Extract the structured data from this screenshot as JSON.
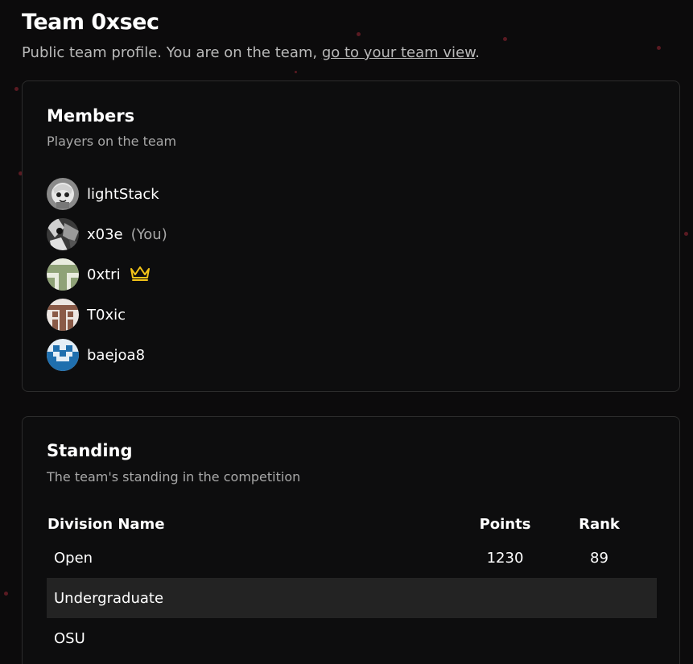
{
  "header": {
    "title": "Team 0xsec",
    "subtitle_prefix": "Public team profile. You are on the team, ",
    "subtitle_link": "go to your team view",
    "subtitle_suffix": "."
  },
  "members_card": {
    "title": "Members",
    "description": "Players on the team",
    "members": [
      {
        "name": "lightStack",
        "you": "",
        "captain": false
      },
      {
        "name": "x03e",
        "you": "(You)",
        "captain": false
      },
      {
        "name": "0xtri",
        "you": "",
        "captain": true
      },
      {
        "name": "T0xic",
        "you": "",
        "captain": false
      },
      {
        "name": "baejoa8",
        "you": "",
        "captain": false
      }
    ]
  },
  "standing_card": {
    "title": "Standing",
    "description": "The team's standing in the competition",
    "columns": [
      "Division Name",
      "Points",
      "Rank"
    ],
    "rows": [
      {
        "division": "Open",
        "points": "1230",
        "rank": "89"
      },
      {
        "division": "Undergraduate",
        "points": "",
        "rank": ""
      },
      {
        "division": "OSU",
        "points": "",
        "rank": ""
      }
    ]
  },
  "colors": {
    "background": "#0c0b0c",
    "card_border": "#2c2c2c",
    "muted_text": "#a8a8a8",
    "crown": "#f5c518",
    "row_highlight": "#232323"
  }
}
